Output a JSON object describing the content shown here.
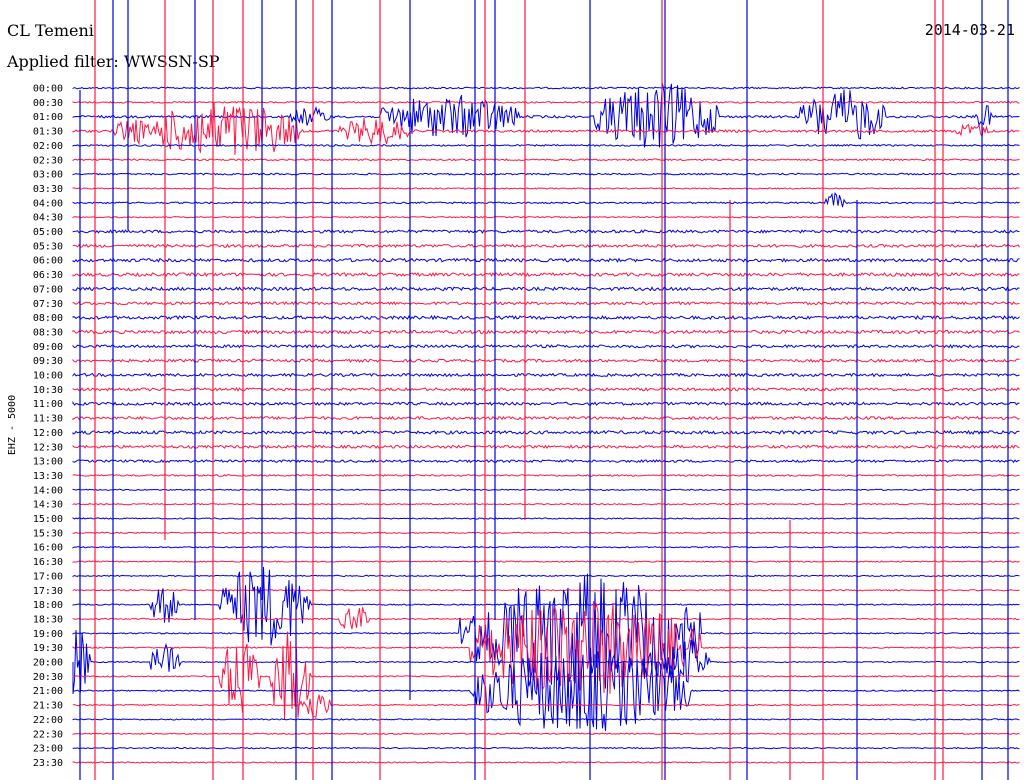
{
  "header": {
    "station": "CL Temeni",
    "date": "2014-03-21",
    "filter_label": "Applied filter:",
    "filter_value": "WWSSN-SP"
  },
  "chart_data": {
    "type": "helicorder",
    "ylabel": "EHZ - 5000",
    "rows": [
      "00:00",
      "00:30",
      "01:00",
      "01:30",
      "02:00",
      "02:30",
      "03:00",
      "03:30",
      "04:00",
      "04:30",
      "05:00",
      "05:30",
      "06:00",
      "06:30",
      "07:00",
      "07:30",
      "08:00",
      "08:30",
      "09:00",
      "09:30",
      "10:00",
      "10:30",
      "11:00",
      "11:30",
      "12:00",
      "12:30",
      "13:00",
      "13:30",
      "14:00",
      "14:30",
      "15:00",
      "15:30",
      "16:00",
      "16:30",
      "17:00",
      "17:30",
      "18:00",
      "18:30",
      "19:00",
      "19:30",
      "20:00",
      "20:30",
      "21:00",
      "21:30",
      "22:00",
      "22:30",
      "23:00",
      "23:30"
    ],
    "colors": {
      "even_rows": "#0000e0",
      "odd_rows": "#ff1744"
    },
    "row_noise_level": [
      0.2,
      0.2,
      0.3,
      0.3,
      0.2,
      0.2,
      0.2,
      0.15,
      0.2,
      0.15,
      0.35,
      0.35,
      0.4,
      0.4,
      0.4,
      0.35,
      0.4,
      0.4,
      0.35,
      0.35,
      0.35,
      0.35,
      0.35,
      0.35,
      0.4,
      0.35,
      0.3,
      0.2,
      0.15,
      0.15,
      0.15,
      0.15,
      0.15,
      0.15,
      0.15,
      0.15,
      0.15,
      0.15,
      0.15,
      0.15,
      0.15,
      0.15,
      0.15,
      0.15,
      0.15,
      0.15,
      0.15,
      0.15
    ]
  }
}
